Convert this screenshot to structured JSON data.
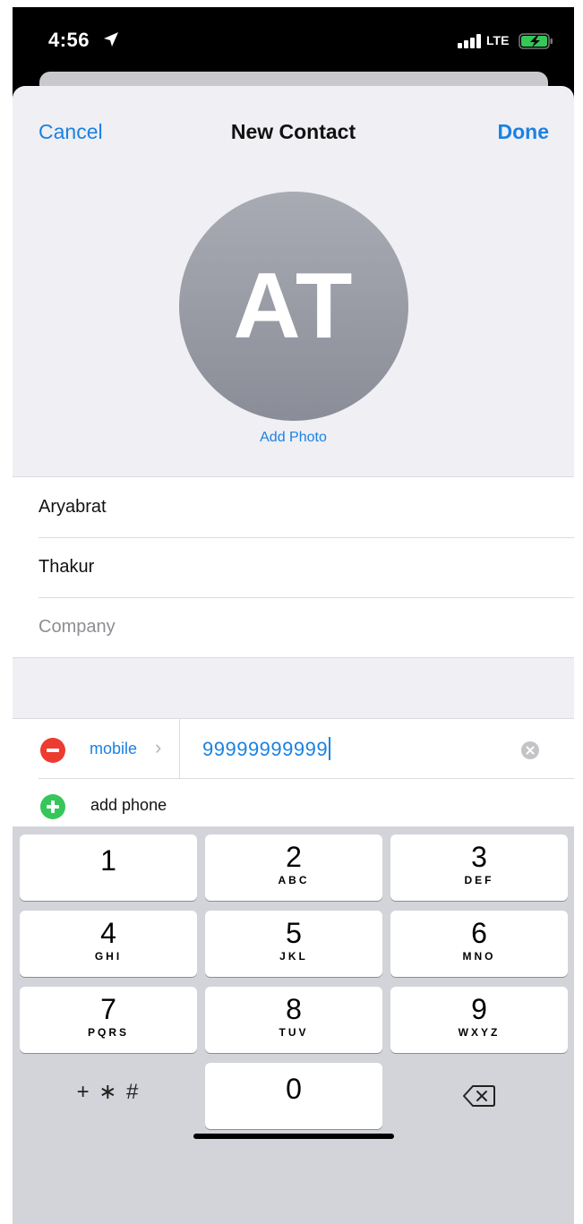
{
  "status_bar": {
    "time": "4:56",
    "network": "LTE"
  },
  "nav": {
    "cancel": "Cancel",
    "title": "New Contact",
    "done": "Done"
  },
  "avatar": {
    "initials": "AT",
    "add_photo": "Add Photo"
  },
  "fields": {
    "first_name": "Aryabrat",
    "last_name": "Thakur",
    "company_placeholder": "Company"
  },
  "phone": {
    "label": "mobile",
    "value": "99999999999",
    "add_label": "add phone"
  },
  "keypad": {
    "keys": [
      {
        "num": "1",
        "letters": ""
      },
      {
        "num": "2",
        "letters": "ABC"
      },
      {
        "num": "3",
        "letters": "DEF"
      },
      {
        "num": "4",
        "letters": "GHI"
      },
      {
        "num": "5",
        "letters": "JKL"
      },
      {
        "num": "6",
        "letters": "MNO"
      },
      {
        "num": "7",
        "letters": "PQRS"
      },
      {
        "num": "8",
        "letters": "TUV"
      },
      {
        "num": "9",
        "letters": "WXYZ"
      }
    ],
    "symbols": "+ ∗ #",
    "zero": "0"
  },
  "colors": {
    "accent": "#1a82e2",
    "delete": "#ed3b30",
    "add": "#35c759"
  }
}
